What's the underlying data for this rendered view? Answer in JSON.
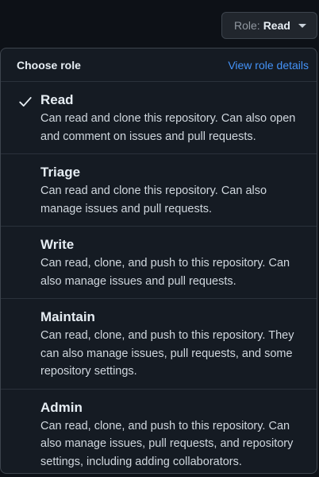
{
  "role_button": {
    "label": "Role:",
    "value": "Read"
  },
  "menu": {
    "title": "Choose role",
    "details_link": "View role details",
    "items": [
      {
        "name": "Read",
        "description": "Can read and clone this repository. Can also open and comment on issues and pull requests.",
        "selected": true
      },
      {
        "name": "Triage",
        "description": "Can read and clone this repository. Can also manage issues and pull requests.",
        "selected": false
      },
      {
        "name": "Write",
        "description": "Can read, clone, and push to this repository. Can also manage issues and pull requests.",
        "selected": false
      },
      {
        "name": "Maintain",
        "description": "Can read, clone, and push to this repository. They can also manage issues, pull requests, and some repository settings.",
        "selected": false
      },
      {
        "name": "Admin",
        "description": "Can read, clone, and push to this repository. Can also manage issues, pull requests, and repository settings, including adding collaborators.",
        "selected": false
      }
    ]
  },
  "colors": {
    "accent": "#4493f8",
    "background": "#0d1117",
    "menu_bg": "#151b23"
  }
}
